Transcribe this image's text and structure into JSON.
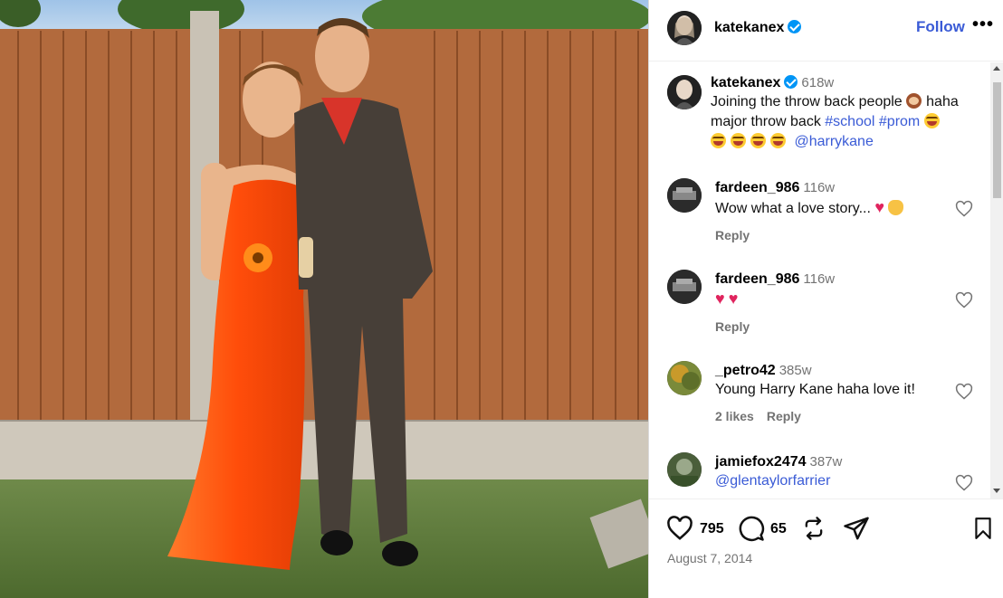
{
  "post": {
    "author": "katekanex",
    "follow_label": "Follow",
    "more_label": "•••",
    "likes": "795",
    "comments_count": "65",
    "date": "August 7, 2014"
  },
  "caption": {
    "username": "katekanex",
    "time": "618w",
    "text_part1": "Joining the throw back people",
    "text_part2": "haha major throw back",
    "hashtag1": "#school",
    "hashtag2": "#prom",
    "mention": "@harrykane"
  },
  "comments": [
    {
      "username": "fardeen_986",
      "time": "116w",
      "text": "Wow what a love story...",
      "reply": "Reply"
    },
    {
      "username": "fardeen_986",
      "time": "116w",
      "text": "",
      "reply": "Reply"
    },
    {
      "username": "_petro42",
      "time": "385w",
      "text": "Young Harry Kane haha love it!",
      "likes": "2 likes",
      "reply": "Reply"
    },
    {
      "username": "jamiefox2474",
      "time": "387w",
      "text": "@glentaylorfarrier"
    }
  ],
  "icons": {
    "verified": "verified-badge-icon",
    "like": "heart-icon",
    "comment": "comment-icon",
    "repost": "repost-icon",
    "share": "share-icon",
    "save": "bookmark-icon"
  },
  "colors": {
    "link": "#3a5bd6",
    "verified": "#0095f6",
    "muted": "#737373",
    "dress": "#ff5a14",
    "fence": "#b06a3c"
  }
}
